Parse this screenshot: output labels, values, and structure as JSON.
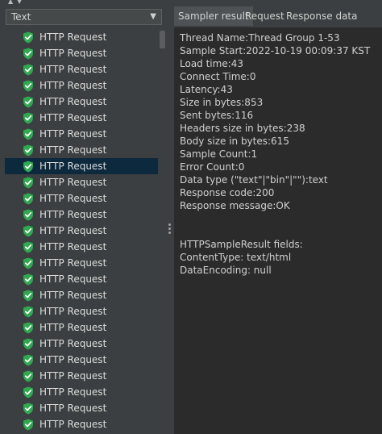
{
  "renderer": {
    "selected": "Text"
  },
  "tree": {
    "items": [
      {
        "label": "HTTP Request",
        "status": "success"
      },
      {
        "label": "HTTP Request",
        "status": "success"
      },
      {
        "label": "HTTP Request",
        "status": "success"
      },
      {
        "label": "HTTP Request",
        "status": "success"
      },
      {
        "label": "HTTP Request",
        "status": "success"
      },
      {
        "label": "HTTP Request",
        "status": "success"
      },
      {
        "label": "HTTP Request",
        "status": "success"
      },
      {
        "label": "HTTP Request",
        "status": "success"
      },
      {
        "label": "HTTP Request",
        "status": "success",
        "selected": true
      },
      {
        "label": "HTTP Request",
        "status": "success"
      },
      {
        "label": "HTTP Request",
        "status": "success"
      },
      {
        "label": "HTTP Request",
        "status": "success"
      },
      {
        "label": "HTTP Request",
        "status": "success"
      },
      {
        "label": "HTTP Request",
        "status": "success"
      },
      {
        "label": "HTTP Request",
        "status": "success"
      },
      {
        "label": "HTTP Request",
        "status": "success"
      },
      {
        "label": "HTTP Request",
        "status": "success"
      },
      {
        "label": "HTTP Request",
        "status": "success"
      },
      {
        "label": "HTTP Request",
        "status": "success"
      },
      {
        "label": "HTTP Request",
        "status": "success"
      },
      {
        "label": "HTTP Request",
        "status": "success"
      },
      {
        "label": "HTTP Request",
        "status": "success"
      },
      {
        "label": "HTTP Request",
        "status": "success"
      },
      {
        "label": "HTTP Request",
        "status": "success"
      },
      {
        "label": "HTTP Request",
        "status": "success"
      }
    ]
  },
  "tabs": [
    {
      "label": "Sampler result",
      "active": true
    },
    {
      "label": "Request",
      "active": false
    },
    {
      "label": "Response data",
      "active": false
    }
  ],
  "sampler_result": {
    "lines": [
      "Thread Name:Thread Group 1-53",
      "Sample Start:2022-10-19 00:09:37 KST",
      "Load time:43",
      "Connect Time:0",
      "Latency:43",
      "Size in bytes:853",
      "Sent bytes:116",
      "Headers size in bytes:238",
      "Body size in bytes:615",
      "Sample Count:1",
      "Error Count:0",
      "Data type (\"text\"|\"bin\"|\"\"):text",
      "Response code:200",
      "Response message:OK",
      "",
      "",
      "HTTPSampleResult fields:",
      "ContentType: text/html",
      "DataEncoding: null"
    ]
  },
  "colors": {
    "background": "#3c3f41",
    "content_background": "#2b2b2b",
    "selection": "#0d293e",
    "success_icon": "#2fa84f",
    "active_tab": "#4e5254"
  },
  "icons": {
    "tree_item": "shield-check-icon",
    "dropdown": "chevron-down-icon",
    "splitter": "grip-icon"
  }
}
